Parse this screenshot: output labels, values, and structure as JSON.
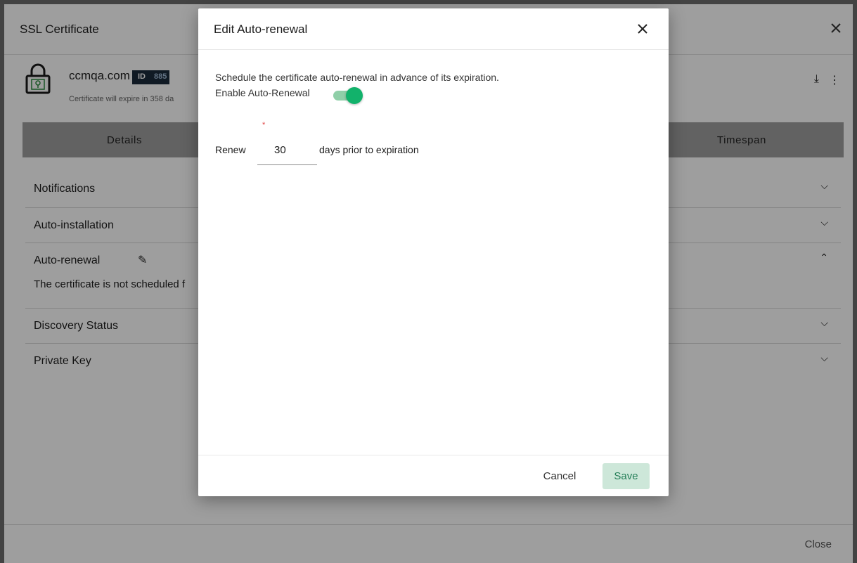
{
  "panel": {
    "title": "SSL Certificate",
    "domain": "ccmqa.com",
    "id_label": "ID",
    "id_value": "885",
    "expire_text": "Certificate will expire in 358 da",
    "tabs": {
      "details": "Details",
      "timespan": "Timespan"
    },
    "sections": [
      {
        "label": "Notifications"
      },
      {
        "label": "Auto-installation"
      },
      {
        "label": "Auto-renewal",
        "sub": "The certificate is not scheduled f"
      },
      {
        "label": "Discovery Status"
      },
      {
        "label": "Private Key"
      }
    ],
    "footer_close": "Close"
  },
  "dialog": {
    "title": "Edit Auto-renewal",
    "description": "Schedule the certificate auto-renewal in advance of its expiration.",
    "toggle_label": "Enable Auto-Renewal",
    "toggle_on": true,
    "required_marker": "*",
    "renew_prefix": "Renew",
    "renew_days": "30",
    "renew_suffix": "days prior to expiration",
    "cancel_label": "Cancel",
    "save_label": "Save"
  },
  "colors": {
    "accent": "#12b26b",
    "save_bg": "#cde7d9",
    "tab_bar": "#9e9e9e"
  }
}
